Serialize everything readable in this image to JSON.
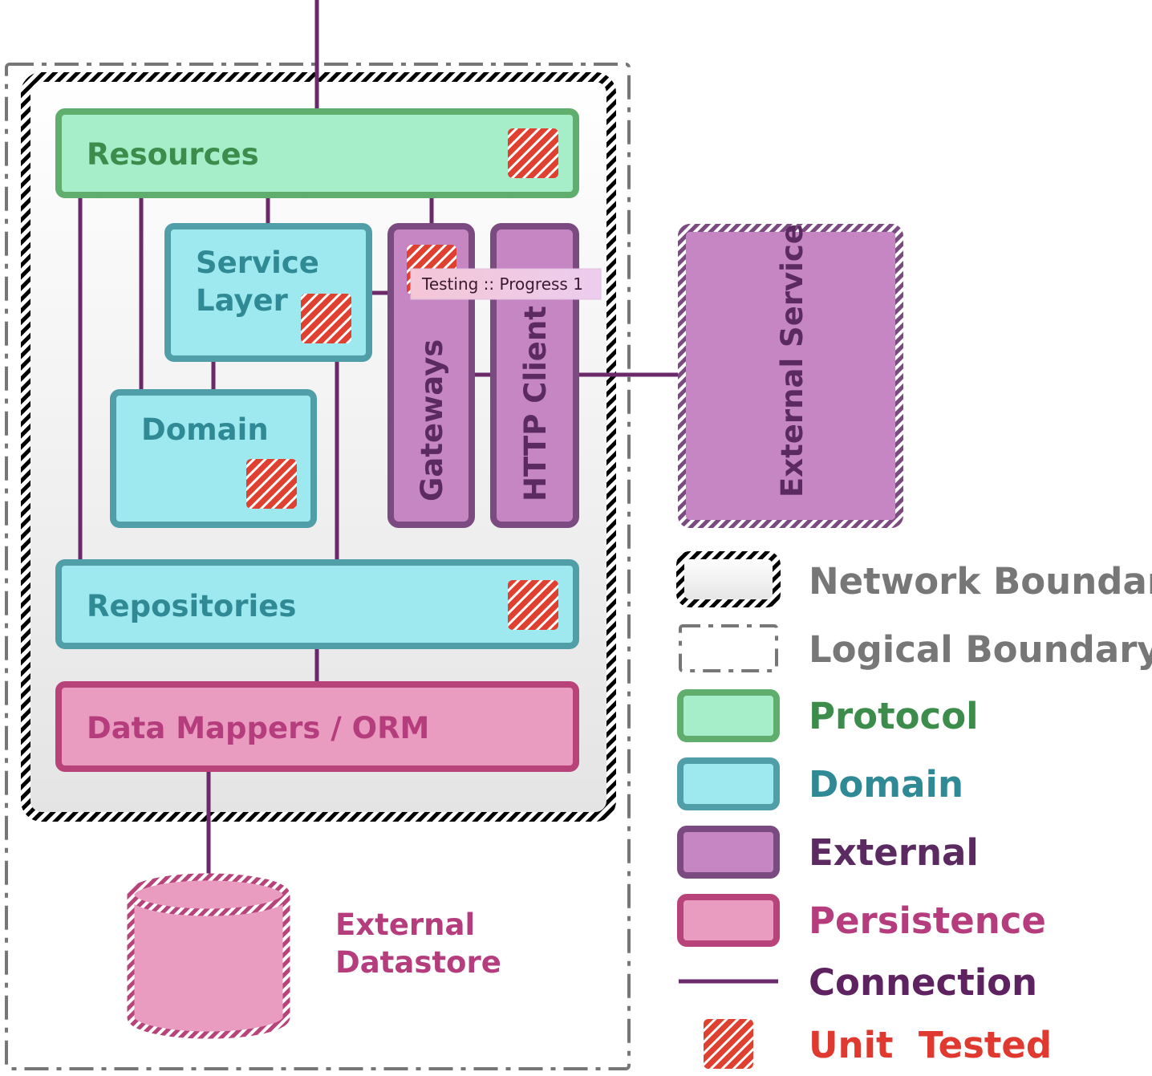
{
  "colors": {
    "protocol_fill": "#a6edca",
    "protocol_stroke": "#5fae6e",
    "protocol_text": "#3c8d4c",
    "domain_fill": "#9ee9ef",
    "domain_stroke": "#4f9ea8",
    "domain_text": "#2f8a95",
    "external_fill": "#c686c4",
    "external_stroke": "#7a4a80",
    "external_text": "#5a2a60",
    "persistence_fill": "#ea9bc0",
    "persistence_stroke": "#b8437a",
    "persistence_text": "#b53d7e",
    "connection": "#6a2a6a",
    "unit_tested": "#e04030",
    "boundary_text": "#777777"
  },
  "components": {
    "resources": "Resources",
    "service_layer_1": "Service",
    "service_layer_2": "Layer",
    "domain": "Domain",
    "gateways": "Gateways",
    "http_client": "HTTP Client",
    "external_service": "External Service",
    "repositories": "Repositories",
    "data_mappers": "Data Mappers / ORM",
    "external_datastore_1": "External",
    "external_datastore_2": "Datastore"
  },
  "tooltip": "Testing :: Progress 1",
  "legend": {
    "network_boundary": "Network Boundary",
    "logical_boundary": "Logical Boundary",
    "protocol": "Protocol",
    "domain": "Domain",
    "external": "External",
    "persistence": "Persistence",
    "connection": "Connection",
    "unit_tested": "Unit  Tested"
  }
}
